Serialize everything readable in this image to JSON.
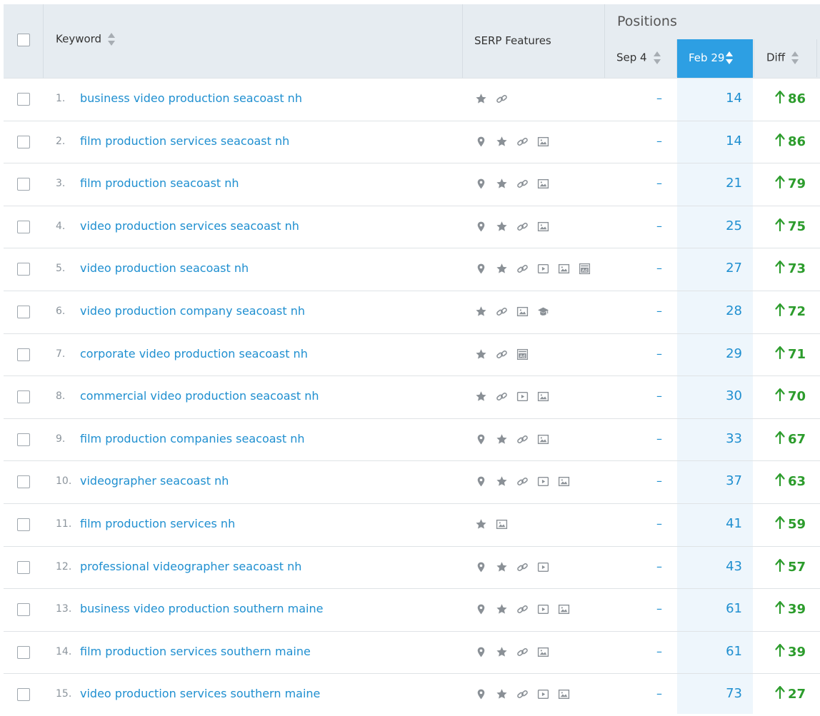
{
  "header": {
    "keyword_label": "Keyword",
    "serp_label": "SERP Features",
    "positions_label": "Positions",
    "sep_label": "Sep 4",
    "feb_label": "Feb 29",
    "diff_label": "Diff"
  },
  "colors": {
    "link": "#1f8fd0",
    "positive": "#2c9c2c",
    "active_header": "#2d9fe3"
  },
  "rows": [
    {
      "num": "1.",
      "keyword": "business video production seacoast nh",
      "features": [
        "star",
        "link"
      ],
      "sep": "–",
      "feb": "14",
      "diff": "86"
    },
    {
      "num": "2.",
      "keyword": "film production services seacoast nh",
      "features": [
        "pin",
        "star",
        "link",
        "image"
      ],
      "sep": "–",
      "feb": "14",
      "diff": "86"
    },
    {
      "num": "3.",
      "keyword": "film production seacoast nh",
      "features": [
        "pin",
        "star",
        "link",
        "image"
      ],
      "sep": "–",
      "feb": "21",
      "diff": "79"
    },
    {
      "num": "4.",
      "keyword": "video production services seacoast nh",
      "features": [
        "pin",
        "star",
        "link",
        "image"
      ],
      "sep": "–",
      "feb": "25",
      "diff": "75"
    },
    {
      "num": "5.",
      "keyword": "video production seacoast nh",
      "features": [
        "pin",
        "star",
        "link",
        "video",
        "image",
        "ad"
      ],
      "sep": "–",
      "feb": "27",
      "diff": "73"
    },
    {
      "num": "6.",
      "keyword": "video production company seacoast nh",
      "features": [
        "star",
        "link",
        "image",
        "academic"
      ],
      "sep": "–",
      "feb": "28",
      "diff": "72"
    },
    {
      "num": "7.",
      "keyword": "corporate video production seacoast nh",
      "features": [
        "star",
        "link",
        "ad"
      ],
      "sep": "–",
      "feb": "29",
      "diff": "71"
    },
    {
      "num": "8.",
      "keyword": "commercial video production seacoast nh",
      "features": [
        "star",
        "link",
        "video",
        "image"
      ],
      "sep": "–",
      "feb": "30",
      "diff": "70"
    },
    {
      "num": "9.",
      "keyword": "film production companies seacoast nh",
      "features": [
        "pin",
        "star",
        "link",
        "image"
      ],
      "sep": "–",
      "feb": "33",
      "diff": "67"
    },
    {
      "num": "10.",
      "keyword": "videographer seacoast nh",
      "features": [
        "pin",
        "star",
        "link",
        "video",
        "image"
      ],
      "sep": "–",
      "feb": "37",
      "diff": "63"
    },
    {
      "num": "11.",
      "keyword": "film production services nh",
      "features": [
        "star",
        "image"
      ],
      "sep": "–",
      "feb": "41",
      "diff": "59"
    },
    {
      "num": "12.",
      "keyword": "professional videographer seacoast nh",
      "features": [
        "pin",
        "star",
        "link",
        "video"
      ],
      "sep": "–",
      "feb": "43",
      "diff": "57"
    },
    {
      "num": "13.",
      "keyword": "business video production southern maine",
      "features": [
        "pin",
        "star",
        "link",
        "video",
        "image"
      ],
      "sep": "–",
      "feb": "61",
      "diff": "39"
    },
    {
      "num": "14.",
      "keyword": "film production services southern maine",
      "features": [
        "pin",
        "star",
        "link",
        "image"
      ],
      "sep": "–",
      "feb": "61",
      "diff": "39"
    },
    {
      "num": "15.",
      "keyword": "video production services southern maine",
      "features": [
        "pin",
        "star",
        "link",
        "video",
        "image"
      ],
      "sep": "–",
      "feb": "73",
      "diff": "27"
    }
  ]
}
